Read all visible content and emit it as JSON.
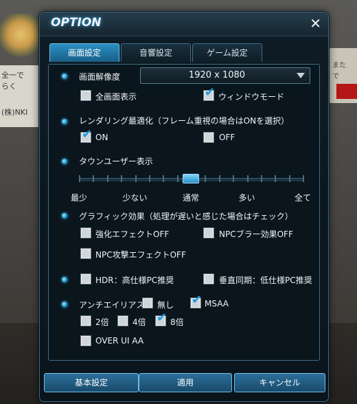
{
  "background": {
    "sign_lines": [
      "全一で",
      "らく",
      "(株)NKI"
    ],
    "right_lines": [
      "また",
      "で"
    ]
  },
  "dialog": {
    "title": "OPTION",
    "close_label": "✕"
  },
  "tabs": [
    {
      "label": "画面設定",
      "active": true
    },
    {
      "label": "音響設定",
      "active": false
    },
    {
      "label": "ゲーム設定",
      "active": false
    }
  ],
  "resolution": {
    "label": "画面解像度",
    "value": "1920 x 1080",
    "fullscreen": {
      "label": "全画面表示",
      "checked": false
    },
    "window": {
      "label": "ウィンドウモード",
      "checked": true
    }
  },
  "rendering": {
    "label": "レンダリング最適化（フレーム重視の場合はONを選択）",
    "on": {
      "label": "ON",
      "checked": true
    },
    "off": {
      "label": "OFF",
      "checked": false
    }
  },
  "town_users": {
    "label": "タウンユーザー表示",
    "levels": [
      "最少",
      "少ない",
      "通常",
      "多い",
      "全て"
    ],
    "selected_index": 2
  },
  "graphics": {
    "label": "グラフィック効果（処理が遅いと感じた場合はチェック）",
    "enhanced_effect_off": {
      "label": "強化エフェクトOFF",
      "checked": false
    },
    "npc_blur_off": {
      "label": "NPCブラー効果OFF",
      "checked": false
    },
    "npc_attack_effect_off": {
      "label": "NPC攻撃エフェクトOFF",
      "checked": false
    }
  },
  "hdr": {
    "label": "HDR：高仕様PC推奨",
    "checked": false
  },
  "vsync": {
    "label": "垂直同期：低仕様PC推奨",
    "checked": false
  },
  "antialias": {
    "label": "アンチエイリアス",
    "none": {
      "label": "無し",
      "checked": false
    },
    "msaa": {
      "label": "MSAA",
      "checked": true
    },
    "x2": {
      "label": "2倍",
      "checked": false
    },
    "x4": {
      "label": "4倍",
      "checked": false
    },
    "x8": {
      "label": "8倍",
      "checked": true
    },
    "over_ui": {
      "label": "OVER UI AA",
      "checked": false
    }
  },
  "buttons": {
    "default": "基本設定",
    "apply": "適用",
    "cancel": "キャンセル"
  },
  "colors": {
    "accent": "#2a9fd6",
    "check": "#1a9ee3",
    "panel_border": "#3f6d86"
  }
}
